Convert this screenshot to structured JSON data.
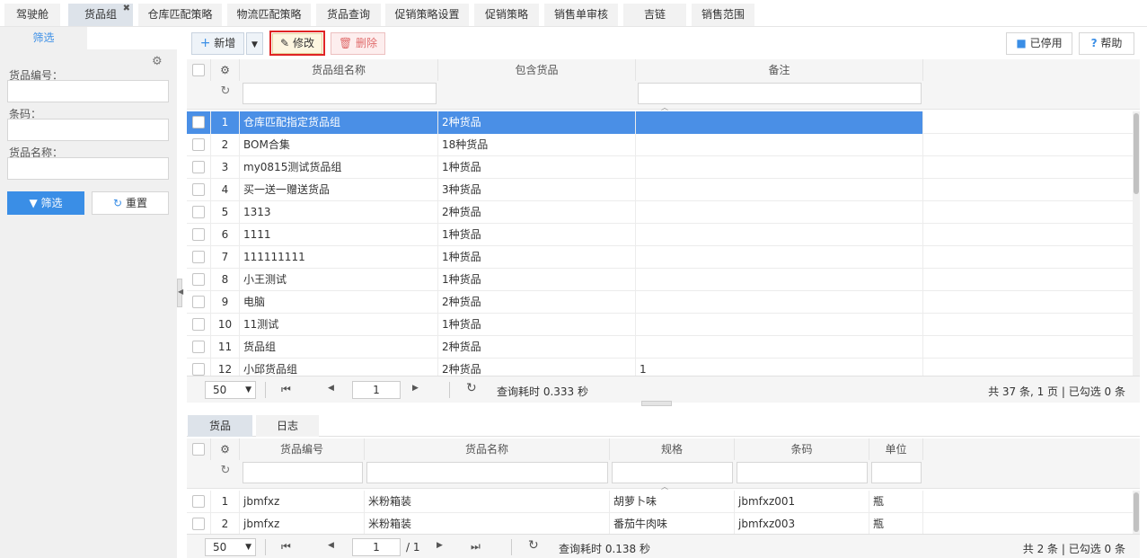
{
  "tabs": [
    {
      "label": "驾驶舱",
      "active": false
    },
    {
      "label": "货品组",
      "active": true
    },
    {
      "label": "仓库匹配策略",
      "active": false
    },
    {
      "label": "物流匹配策略",
      "active": false
    },
    {
      "label": "货品查询",
      "active": false
    },
    {
      "label": "促销策略设置",
      "active": false
    },
    {
      "label": "促销策略",
      "active": false
    },
    {
      "label": "销售单审核",
      "active": false
    },
    {
      "label": "吉链",
      "active": false
    },
    {
      "label": "销售范围",
      "active": false
    }
  ],
  "tab_close": "✖",
  "filter": {
    "tab_label": "筛选",
    "fields": [
      {
        "label": "货品编号：",
        "value": ""
      },
      {
        "label": "条码：",
        "value": ""
      },
      {
        "label": "货品名称：",
        "value": ""
      }
    ],
    "filter_button": "筛选",
    "reset_button": "重置"
  },
  "toolbar": {
    "add": "新增",
    "edit": "修改",
    "delete": "删除",
    "disabled": "已停用",
    "help": "帮助"
  },
  "main_grid": {
    "columns": [
      "货品组名称",
      "包含货品",
      "备注"
    ],
    "rows": [
      {
        "n": "1",
        "name": "仓库匹配指定货品组",
        "count": "2种货品",
        "note": "",
        "selected": true
      },
      {
        "n": "2",
        "name": "BOM合集",
        "count": "18种货品",
        "note": ""
      },
      {
        "n": "3",
        "name": "my0815测试货品组",
        "count": "1种货品",
        "note": ""
      },
      {
        "n": "4",
        "name": "买一送一赠送货品",
        "count": "3种货品",
        "note": ""
      },
      {
        "n": "5",
        "name": "1313",
        "count": "2种货品",
        "note": ""
      },
      {
        "n": "6",
        "name": "1111",
        "count": "1种货品",
        "note": ""
      },
      {
        "n": "7",
        "name": "111111111",
        "count": "1种货品",
        "note": ""
      },
      {
        "n": "8",
        "name": "小王测试",
        "count": "1种货品",
        "note": ""
      },
      {
        "n": "9",
        "name": "电脑",
        "count": "2种货品",
        "note": ""
      },
      {
        "n": "10",
        "name": "11测试",
        "count": "1种货品",
        "note": ""
      },
      {
        "n": "11",
        "name": "货品组",
        "count": "2种货品",
        "note": ""
      },
      {
        "n": "12",
        "name": "小邱货品组",
        "count": "2种货品",
        "note": "1"
      }
    ],
    "pager": {
      "page_size": "50",
      "page": "1",
      "elapsed": "查询耗时 0.333 秒",
      "summary": "共 37 条, 1 页 | 已勾选 0 条"
    }
  },
  "bottom_tabs": [
    "货品",
    "日志"
  ],
  "detail_grid": {
    "columns": [
      "货品编号",
      "货品名称",
      "规格",
      "条码",
      "单位"
    ],
    "rows": [
      {
        "n": "1",
        "code": "jbmfxz",
        "name": "米粉箱装",
        "spec": "胡萝卜味",
        "barcode": "jbmfxz001",
        "unit": "瓶"
      },
      {
        "n": "2",
        "code": "jbmfxz",
        "name": "米粉箱装",
        "spec": "番茄牛肉味",
        "barcode": "jbmfxz003",
        "unit": "瓶"
      }
    ],
    "pager": {
      "page_size": "50",
      "page": "1",
      "total_pages": "/ 1",
      "elapsed": "查询耗时 0.138 秒",
      "summary": "共 2 条 | 已勾选 0 条"
    }
  },
  "colors": {
    "accent": "#3a8ee6",
    "selected_row": "#4a8fe6",
    "delete_text": "#e06c6c",
    "edit_highlight": "#e02424"
  }
}
